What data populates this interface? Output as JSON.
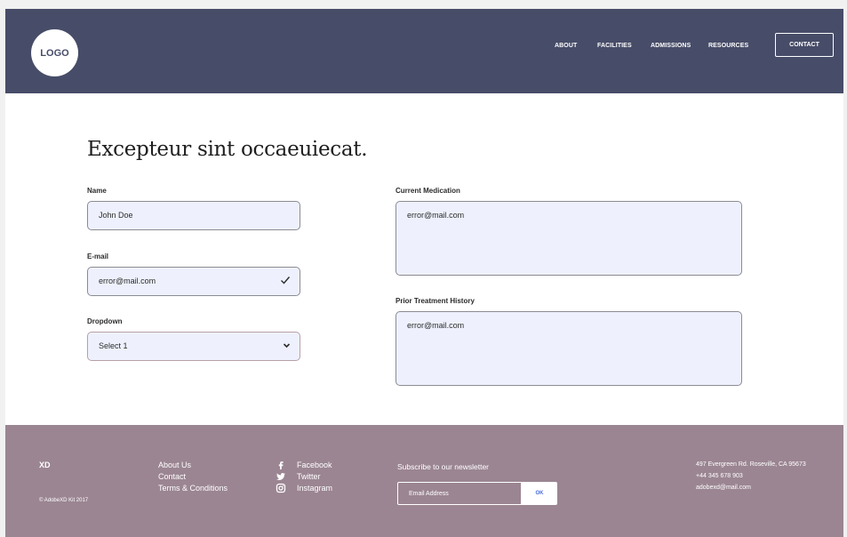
{
  "header": {
    "logo": "LOGO",
    "nav": [
      "ABOUT",
      "FACILITIES",
      "ADMISSIONS",
      "RESOURCES"
    ],
    "contact_button": "CONTACT"
  },
  "main": {
    "title": "Excepteur sint occaeuiecat.",
    "name": {
      "label": "Name",
      "value": "John Doe"
    },
    "email": {
      "label": "E-mail",
      "value": "error@mail.com",
      "icon": "check-icon"
    },
    "dropdown": {
      "label": "Dropdown",
      "value": "Select 1",
      "icon": "chevron-down-icon"
    },
    "current_medication": {
      "label": "Current Medication",
      "value": "error@mail.com"
    },
    "prior_treatment": {
      "label": "Prior Treatment History",
      "value": "error@mail.com"
    }
  },
  "footer": {
    "brand": "XD",
    "copyright": "© AdobeXD Kit 2017",
    "links": [
      "About Us",
      "Contact",
      "Terms & Conditions"
    ],
    "social": [
      {
        "label": "Facebook",
        "icon": "facebook-icon"
      },
      {
        "label": "Twitter",
        "icon": "twitter-icon"
      },
      {
        "label": "Instagram",
        "icon": "instagram-icon"
      }
    ],
    "newsletter": {
      "heading": "Subscribe to our newsletter",
      "placeholder": "Email Address",
      "button": "OK"
    },
    "contact": [
      "497 Evergreen Rd. Roseville, CA 95673",
      "+44 345 678 903",
      "adobexd@mail.com"
    ]
  },
  "colors": {
    "header_bg": "#474c68",
    "footer_bg": "#9b8592",
    "field_bg": "#eef1fd",
    "ok_text": "#4a6ee0"
  }
}
